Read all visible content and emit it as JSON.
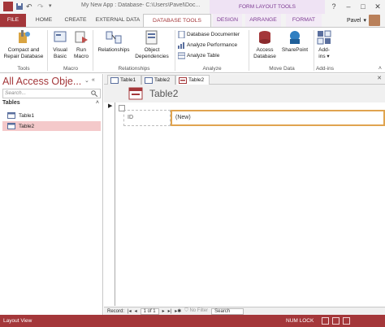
{
  "titlebar": {
    "title": "My New App : Database- C:\\Users\\Pavel\\Doc...",
    "contextual_header": "FORM LAYOUT TOOLS",
    "help": "?",
    "minimize": "–",
    "restore": "□",
    "close": "✕"
  },
  "tabs": {
    "file": "FILE",
    "home": "HOME",
    "create": "CREATE",
    "external_data": "EXTERNAL DATA",
    "database_tools": "DATABASE TOOLS",
    "design": "DESIGN",
    "arrange": "ARRANGE",
    "format": "FORMAT"
  },
  "user": {
    "name": "Pavel"
  },
  "ribbon": {
    "tools": {
      "compact_line1": "Compact and",
      "compact_line2": "Repair Database",
      "label": "Tools"
    },
    "macro": {
      "vb_line1": "Visual",
      "vb_line2": "Basic",
      "run_line1": "Run",
      "run_line2": "Macro",
      "label": "Macro"
    },
    "relationships": {
      "rel": "Relationships",
      "obj_line1": "Object",
      "obj_line2": "Dependencies",
      "label": "Relationships"
    },
    "analyze": {
      "documenter": "Database Documenter",
      "performance": "Analyze Performance",
      "table": "Analyze Table",
      "label": "Analyze"
    },
    "move_data": {
      "access_line1": "Access",
      "access_line2": "Database",
      "sharepoint": "SharePoint",
      "label": "Move Data"
    },
    "addins": {
      "addins_line1": "Add-",
      "addins_line2": "ins ▾",
      "label": "Add-ins"
    }
  },
  "nav": {
    "header": "All Access Obje...",
    "search_placeholder": "Search...",
    "group": "Tables",
    "items": [
      {
        "label": "Table1"
      },
      {
        "label": "Table2"
      }
    ]
  },
  "doc_tabs": [
    {
      "label": "Table1"
    },
    {
      "label": "Table2"
    },
    {
      "label": "Table2"
    }
  ],
  "form": {
    "title": "Table2",
    "field_label": "ID",
    "field_value": "(New)"
  },
  "recnav": {
    "record_label": "Record:",
    "position": "1 of 1",
    "filter": "No Filter",
    "search": "Search"
  },
  "status": {
    "view": "Layout View",
    "numlock": "NUM LOCK"
  },
  "colors": {
    "accent": "#a4373a",
    "contextual": "#7d3a93",
    "selection": "#f4c9ca"
  }
}
